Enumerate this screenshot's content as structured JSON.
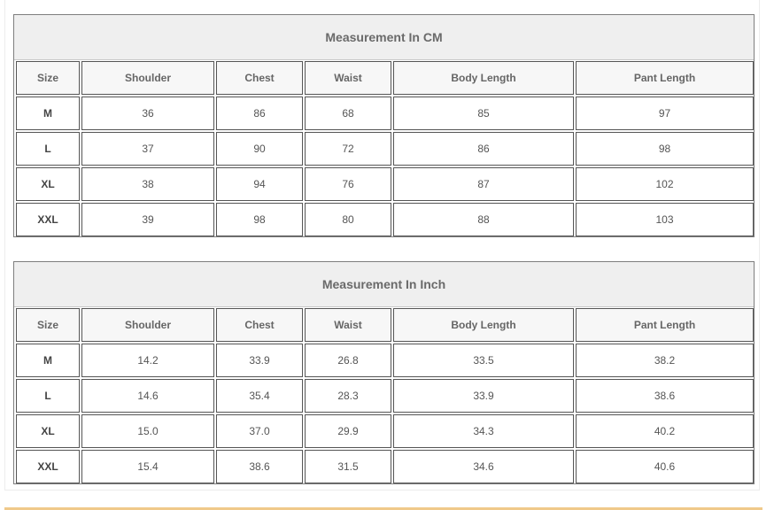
{
  "tables": [
    {
      "title": "Measurement In CM",
      "headers": [
        "Size",
        "Shoulder",
        "Chest",
        "Waist",
        "Body Length",
        "Pant Length"
      ],
      "rows": [
        [
          "M",
          "36",
          "86",
          "68",
          "85",
          "97"
        ],
        [
          "L",
          "37",
          "90",
          "72",
          "86",
          "98"
        ],
        [
          "XL",
          "38",
          "94",
          "76",
          "87",
          "102"
        ],
        [
          "XXL",
          "39",
          "98",
          "80",
          "88",
          "103"
        ]
      ]
    },
    {
      "title": "Measurement In Inch",
      "headers": [
        "Size",
        "Shoulder",
        "Chest",
        "Waist",
        "Body Length",
        "Pant Length"
      ],
      "rows": [
        [
          "M",
          "14.2",
          "33.9",
          "26.8",
          "33.5",
          "38.2"
        ],
        [
          "L",
          "14.6",
          "35.4",
          "28.3",
          "33.9",
          "38.6"
        ],
        [
          "XL",
          "15.0",
          "37.0",
          "29.9",
          "34.3",
          "40.2"
        ],
        [
          "XXL",
          "15.4",
          "38.6",
          "31.5",
          "34.6",
          "40.6"
        ]
      ]
    }
  ],
  "colors": {
    "accent_bar": "#f0c98a",
    "caption_bg": "#efefef",
    "border": "#555555"
  }
}
